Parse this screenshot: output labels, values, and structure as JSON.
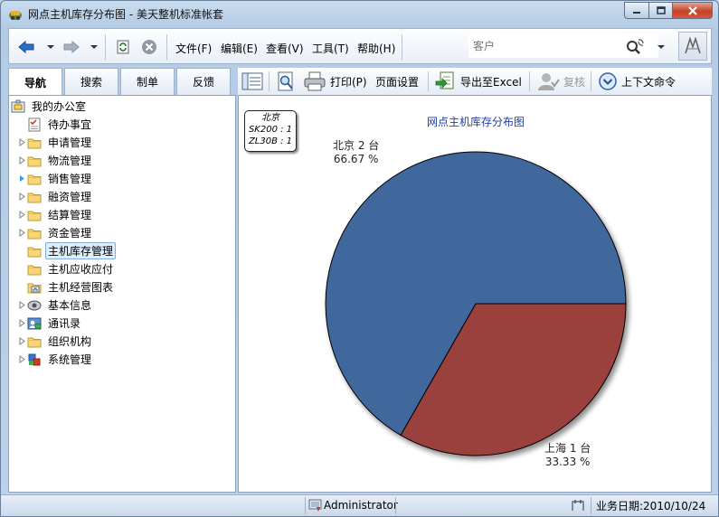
{
  "window": {
    "title": "网点主机库存分布图 - 美天整机标准帐套"
  },
  "menu": {
    "file": "文件(F)",
    "edit": "编辑(E)",
    "view": "查看(V)",
    "tools": "工具(T)",
    "help": "帮助(H)"
  },
  "search": {
    "placeholder": "客户"
  },
  "tabs": [
    "导航",
    "搜索",
    "制单",
    "反馈"
  ],
  "active_tab": "导航",
  "toolbar": {
    "print": "打印(P)",
    "page_setup": "页面设置",
    "export_excel": "导出至Excel",
    "review": "复核",
    "context_commands": "上下文命令"
  },
  "nav_tree": {
    "root": "我的办公室",
    "items": [
      {
        "label": "待办事宜",
        "icon": "todo-icon"
      },
      {
        "label": "申请管理",
        "icon": "folder-icon"
      },
      {
        "label": "物流管理",
        "icon": "folder-icon"
      },
      {
        "label": "销售管理",
        "icon": "folder-icon"
      },
      {
        "label": "融资管理",
        "icon": "folder-icon"
      },
      {
        "label": "结算管理",
        "icon": "folder-icon"
      },
      {
        "label": "资金管理",
        "icon": "folder-icon"
      },
      {
        "label": "主机库存管理",
        "icon": "folder-icon"
      },
      {
        "label": "主机应收应付",
        "icon": "folder-icon"
      },
      {
        "label": "主机经营图表",
        "icon": "report-icon"
      },
      {
        "label": "基本信息",
        "icon": "info-icon"
      },
      {
        "label": "通讯录",
        "icon": "contacts-icon"
      },
      {
        "label": "组织机构",
        "icon": "folder-icon"
      },
      {
        "label": "系统管理",
        "icon": "settings-icon"
      }
    ]
  },
  "legend": {
    "title": "北京",
    "lines": [
      "SK200 : 1",
      "ZL30B : 1"
    ]
  },
  "chart_data": {
    "type": "pie",
    "title": "网点主机库存分布图",
    "slices": [
      {
        "name": "北京",
        "value": 2,
        "unit": "台",
        "label": "北京 2 台",
        "percent_label": "66.67 %",
        "color": "#3f679c"
      },
      {
        "name": "上海",
        "value": 1,
        "unit": "台",
        "label": "上海 1 台",
        "percent_label": "33.33 %",
        "color": "#9a3f3c"
      }
    ]
  },
  "status": {
    "user": "Administrator",
    "business_date": "业务日期:2010/10/24"
  },
  "colors": {
    "chart_title": "#1f3fa8",
    "beijing_slice": "#3f679c",
    "shanghai_slice": "#9a3f3c"
  }
}
